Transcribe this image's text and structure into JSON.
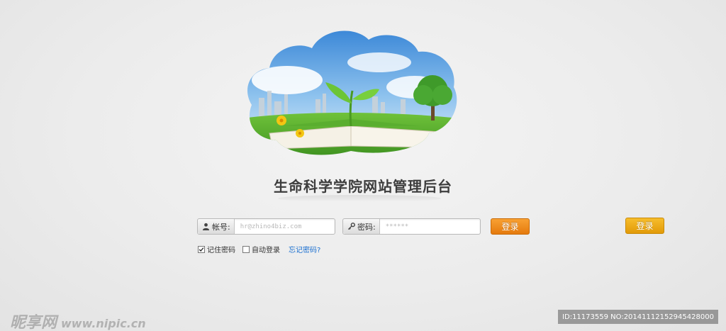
{
  "site": {
    "title": "生命科学学院网站管理后台"
  },
  "login": {
    "account_label": "帐号:",
    "account_placeholder": "hr@zhino4biz.com",
    "password_label": "密码:",
    "password_placeholder": "******",
    "submit_label": "登录",
    "submit_label_alt": "登录",
    "remember_label": "记住密码",
    "remember_checked": true,
    "auto_login_label": "自动登录",
    "auto_login_checked": false,
    "forgot_label": "忘记密码?"
  },
  "watermark": {
    "brand": "昵享网",
    "url": "www.nipic.cn",
    "id_text": "ID:11173559 NO:20141112152945428000"
  },
  "icons": {
    "account": "user-icon",
    "password": "key-icon",
    "checkbox": "checkmark-icon"
  },
  "colors": {
    "button_primary": "#e57a0d",
    "button_alt": "#e29a08",
    "link": "#1a6fd0"
  }
}
